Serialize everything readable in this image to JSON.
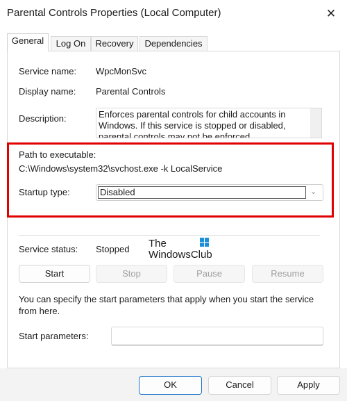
{
  "window": {
    "title": "Parental Controls Properties (Local Computer)",
    "close_glyph": "✕"
  },
  "tabs": [
    {
      "label": "General",
      "active": true
    },
    {
      "label": "Log On"
    },
    {
      "label": "Recovery"
    },
    {
      "label": "Dependencies"
    }
  ],
  "general": {
    "service_name_label": "Service name:",
    "service_name": "WpcMonSvc",
    "display_name_label": "Display name:",
    "display_name": "Parental Controls",
    "description_label": "Description:",
    "description": "Enforces parental controls for child accounts in Windows. If this service is stopped or disabled, parental controls may not be enforced.",
    "path_label": "Path to executable:",
    "path": "C:\\Windows\\system32\\svchost.exe -k LocalService",
    "startup_type_label": "Startup type:",
    "startup_type": "Disabled",
    "service_status_label": "Service status:",
    "service_status": "Stopped",
    "start_params_note": "You can specify the start parameters that apply when you start the service from here.",
    "start_params_label": "Start parameters:",
    "start_params_value": ""
  },
  "service_buttons": {
    "start": "Start",
    "stop": "Stop",
    "pause": "Pause",
    "resume": "Resume"
  },
  "footer": {
    "ok": "OK",
    "cancel": "Cancel",
    "apply": "Apply"
  },
  "watermark": {
    "line1": "The",
    "line2": "WindowsClub"
  },
  "colors": {
    "highlight_border": "#e00000",
    "accent": "#1a73c9"
  }
}
